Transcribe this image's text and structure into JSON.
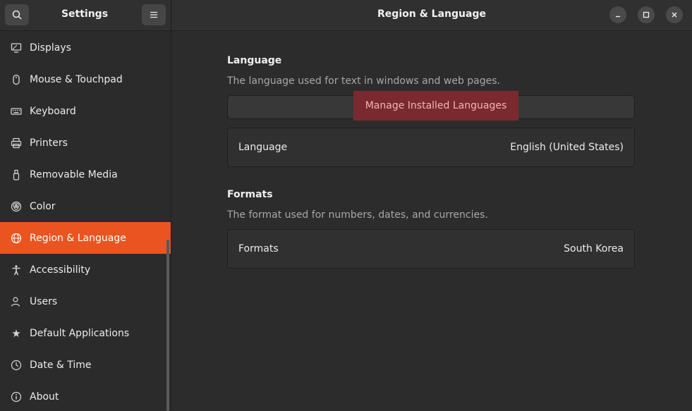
{
  "sidebar": {
    "title": "Settings",
    "search_icon": "search-icon",
    "menu_icon": "hamburger-menu-icon",
    "items": [
      {
        "label": "Displays",
        "icon": "display-icon"
      },
      {
        "label": "Mouse & Touchpad",
        "icon": "mouse-icon"
      },
      {
        "label": "Keyboard",
        "icon": "keyboard-icon"
      },
      {
        "label": "Printers",
        "icon": "printer-icon"
      },
      {
        "label": "Removable Media",
        "icon": "usb-icon"
      },
      {
        "label": "Color",
        "icon": "color-icon"
      },
      {
        "label": "Region & Language",
        "icon": "globe-icon",
        "active": true
      },
      {
        "label": "Accessibility",
        "icon": "accessibility-icon"
      },
      {
        "label": "Users",
        "icon": "users-icon"
      },
      {
        "label": "Default Applications",
        "icon": "star-icon"
      },
      {
        "label": "Date & Time",
        "icon": "clock-icon"
      },
      {
        "label": "About",
        "icon": "info-icon"
      }
    ]
  },
  "header": {
    "title": "Region & Language",
    "window_controls": [
      "minimize",
      "maximize",
      "close"
    ]
  },
  "language_section": {
    "title": "Language",
    "description": "The language used for text in windows and web pages.",
    "manage_button": "Manage Installed Languages",
    "row_label": "Language",
    "row_value": "English (United States)"
  },
  "formats_section": {
    "title": "Formats",
    "description": "The format used for numbers, dates, and currencies.",
    "row_label": "Formats",
    "row_value": "South Korea"
  },
  "colors": {
    "accent": "#e95420",
    "background": "#2c2c2c",
    "highlight": "#7a2a2e"
  }
}
